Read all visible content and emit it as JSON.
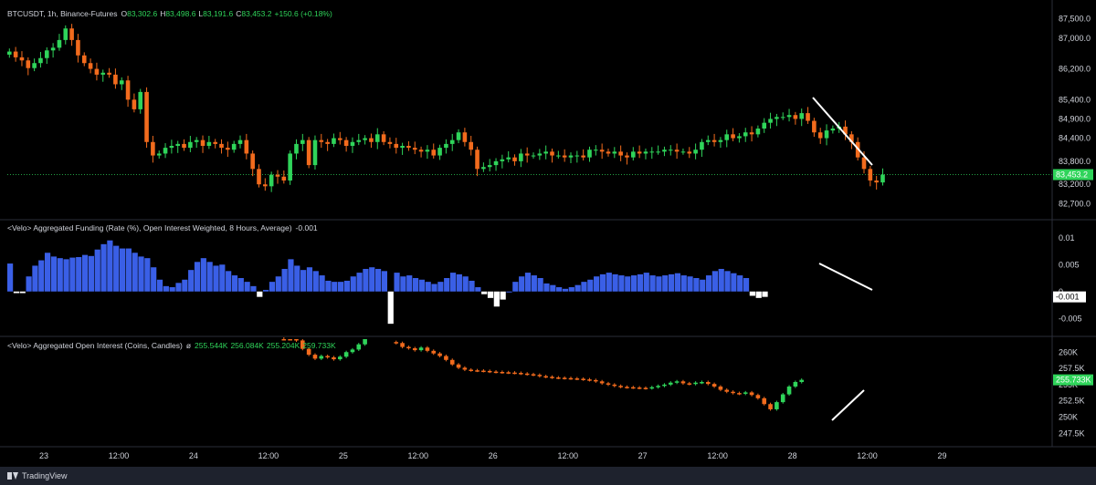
{
  "chart_data": {
    "type": "candlestick",
    "symbol_line": {
      "symbol": "BTCUSDT, 1h, Binance-Futures",
      "o_label": "O",
      "o_value": "83,302.6",
      "h_label": "H",
      "h_value": "83,498.6",
      "l_label": "L",
      "l_value": "83,191.6",
      "c_label": "C",
      "c_value": "83,453.2",
      "change": "+150.6 (+0.18%)"
    },
    "price": {
      "ylim": [
        82400,
        87800
      ],
      "yticks": [
        "87,500.0",
        "87,000.0",
        "86,200.0",
        "85,400.0",
        "84,900.0",
        "84,400.0",
        "83,800.0",
        "83,200.0",
        "82,700.0"
      ],
      "ytick_values": [
        87500,
        87000,
        86200,
        85400,
        84900,
        84400,
        83800,
        83200,
        82700
      ],
      "last_label": "83,453.2",
      "last_value": 83453.2,
      "closes": [
        86650,
        86500,
        86420,
        86220,
        86350,
        86480,
        86680,
        86750,
        86950,
        87250,
        86950,
        86550,
        86350,
        86200,
        86050,
        86100,
        86050,
        85800,
        85900,
        85400,
        85150,
        85600,
        84300,
        83950,
        84000,
        84150,
        84200,
        84250,
        84150,
        84300,
        84350,
        84200,
        84300,
        84250,
        84150,
        84100,
        84250,
        84350,
        84000,
        83600,
        83200,
        83150,
        83450,
        83400,
        83300,
        84000,
        84250,
        84350,
        83700,
        84350,
        84300,
        84250,
        84400,
        84350,
        84200,
        84300,
        84350,
        84400,
        84300,
        84500,
        84300,
        84250,
        84150,
        84200,
        84150,
        84100,
        84050,
        84100,
        83950,
        84150,
        84250,
        84350,
        84550,
        84300,
        84100,
        83600,
        83650,
        83700,
        83800,
        83850,
        83900,
        83800,
        84000,
        83950,
        83950,
        84000,
        84050,
        83950,
        83950,
        83900,
        83950,
        83950,
        83900,
        84100,
        84100,
        84050,
        84000,
        84050,
        83950,
        83900,
        84050,
        84000,
        84050,
        84050,
        84050,
        84100,
        84100,
        84050,
        84050,
        84000,
        84100,
        84300,
        84350,
        84300,
        84350,
        84500,
        84400,
        84450,
        84550,
        84500,
        84650,
        84800,
        84900,
        84950,
        84950,
        85000,
        84900,
        85050,
        84850,
        84550,
        84400,
        84600,
        84650,
        84700,
        84500,
        84300,
        83900,
        83600,
        83300,
        83250,
        83453
      ],
      "annotation_line": "downward trend line"
    },
    "funding": {
      "title": "<Velo> Aggregated Funding (Rate (%), Open Interest Weighted, 8 Hours, Average)",
      "value": "-0.001",
      "ylim": [
        -0.0075,
        0.0125
      ],
      "yticks": [
        "0.01",
        "0.005",
        "0",
        "-0.005"
      ],
      "ytick_values": [
        0.01,
        0.005,
        0,
        -0.005
      ],
      "last_label": "-0.001",
      "values": [
        0.0052,
        -0.0003,
        -0.0003,
        0.0028,
        0.0048,
        0.0058,
        0.0072,
        0.0065,
        0.0062,
        0.006,
        0.0063,
        0.0064,
        0.0068,
        0.0066,
        0.0078,
        0.0088,
        0.0095,
        0.0085,
        0.008,
        0.008,
        0.0072,
        0.0065,
        0.0062,
        0.0045,
        0.0022,
        0.001,
        0.0008,
        0.0016,
        0.0022,
        0.004,
        0.0055,
        0.0062,
        0.0055,
        0.0048,
        0.005,
        0.0038,
        0.003,
        0.0025,
        0.0018,
        0.001,
        -0.001,
        0.0003,
        0.0018,
        0.0028,
        0.0042,
        0.006,
        0.0048,
        0.004,
        0.0045,
        0.0038,
        0.003,
        0.002,
        0.0018,
        0.0018,
        0.002,
        0.0028,
        0.0035,
        0.0042,
        0.0045,
        0.0042,
        0.0038,
        -0.006,
        0.0035,
        0.0028,
        0.003,
        0.0025,
        0.0022,
        0.0018,
        0.0014,
        0.0018,
        0.0025,
        0.0035,
        0.0032,
        0.0028,
        0.002,
        0.0008,
        -0.0005,
        -0.0012,
        -0.0028,
        -0.0015,
        0.0,
        0.0018,
        0.0028,
        0.0035,
        0.003,
        0.0025,
        0.0015,
        0.0012,
        0.0008,
        0.0005,
        0.0008,
        0.0012,
        0.0018,
        0.0022,
        0.0028,
        0.0032,
        0.0035,
        0.0032,
        0.003,
        0.0028,
        0.003,
        0.0032,
        0.0035,
        0.003,
        0.0028,
        0.003,
        0.0032,
        0.0034,
        0.003,
        0.0028,
        0.0025,
        0.0022,
        0.003,
        0.0038,
        0.0042,
        0.0038,
        0.0034,
        0.003,
        0.0025,
        -0.0008,
        -0.0012,
        -0.001
      ]
    },
    "open_interest": {
      "title": "<Velo> Aggregated Open Interest (Coins, Candles)",
      "symbol": "ø",
      "o_value": "255.544K",
      "h_value": "256.084K",
      "l_value": "255.204K",
      "c_value": "259.733K",
      "ylim": [
        246000,
        262000
      ],
      "yticks": [
        "260K",
        "257.5K",
        "255K",
        "252.5K",
        "250K",
        "247.5K"
      ],
      "ytick_values": [
        260000,
        257500,
        255000,
        252500,
        250000,
        247500
      ],
      "last_label": "255.733K",
      "last_value": 255733,
      "candles": [
        [
          44,
          262500
        ],
        [
          45,
          262200
        ],
        [
          46,
          261800
        ],
        [
          47,
          260500
        ],
        [
          48,
          259600
        ],
        [
          49,
          259000
        ],
        [
          50,
          259400
        ],
        [
          51,
          259200
        ],
        [
          52,
          258900
        ],
        [
          53,
          259300
        ],
        [
          54,
          260000
        ],
        [
          55,
          260400
        ],
        [
          56,
          261200
        ],
        [
          57,
          262000
        ],
        [
          62,
          261400
        ],
        [
          63,
          260800
        ],
        [
          64,
          260600
        ],
        [
          65,
          260300
        ],
        [
          66,
          260700
        ],
        [
          67,
          260200
        ],
        [
          68,
          259800
        ],
        [
          69,
          259400
        ],
        [
          70,
          258800
        ],
        [
          71,
          258100
        ],
        [
          72,
          257600
        ],
        [
          73,
          257300
        ],
        [
          74,
          257200
        ],
        [
          75,
          257150
        ],
        [
          76,
          257100
        ],
        [
          77,
          257000
        ],
        [
          78,
          256950
        ],
        [
          79,
          256900
        ],
        [
          80,
          256850
        ],
        [
          81,
          256800
        ],
        [
          82,
          256700
        ],
        [
          83,
          256600
        ],
        [
          84,
          256500
        ],
        [
          85,
          256300
        ],
        [
          86,
          256200
        ],
        [
          87,
          256100
        ],
        [
          88,
          256050
        ],
        [
          89,
          256000
        ],
        [
          90,
          255950
        ],
        [
          91,
          255900
        ],
        [
          92,
          255800
        ],
        [
          93,
          255700
        ],
        [
          94,
          255500
        ],
        [
          95,
          255200
        ],
        [
          96,
          255000
        ],
        [
          97,
          254800
        ],
        [
          98,
          254650
        ],
        [
          99,
          254600
        ],
        [
          100,
          254550
        ],
        [
          101,
          254500
        ],
        [
          102,
          254450
        ],
        [
          103,
          254600
        ],
        [
          104,
          254800
        ],
        [
          105,
          255000
        ],
        [
          106,
          255300
        ],
        [
          107,
          255500
        ],
        [
          108,
          255200
        ],
        [
          109,
          255100
        ],
        [
          110,
          255300
        ],
        [
          111,
          255400
        ],
        [
          112,
          255100
        ],
        [
          113,
          254700
        ],
        [
          114,
          254200
        ],
        [
          115,
          253900
        ],
        [
          116,
          253700
        ],
        [
          117,
          253600
        ],
        [
          118,
          253800
        ],
        [
          119,
          253400
        ],
        [
          120,
          252900
        ],
        [
          121,
          252000
        ],
        [
          122,
          251200
        ],
        [
          123,
          252300
        ],
        [
          124,
          253500
        ],
        [
          125,
          254700
        ],
        [
          126,
          255400
        ],
        [
          127,
          255733
        ]
      ],
      "annotation_line": "upward trend line"
    },
    "x_axis": {
      "labels": [
        "23",
        "12:00",
        "24",
        "12:00",
        "25",
        "12:00",
        "26",
        "12:00",
        "27",
        "12:00",
        "28",
        "12:00",
        "29"
      ],
      "positions": [
        0,
        12,
        24,
        36,
        48,
        60,
        72,
        84,
        96,
        108,
        120,
        132,
        144
      ]
    },
    "colors": {
      "up": "#2fd45a",
      "down": "#f26b1d",
      "funding_pos": "#3a5fe6",
      "funding_neg": "#ffffff",
      "last_price": "#2fd45a"
    }
  },
  "footer": {
    "brand": "TradingView"
  }
}
